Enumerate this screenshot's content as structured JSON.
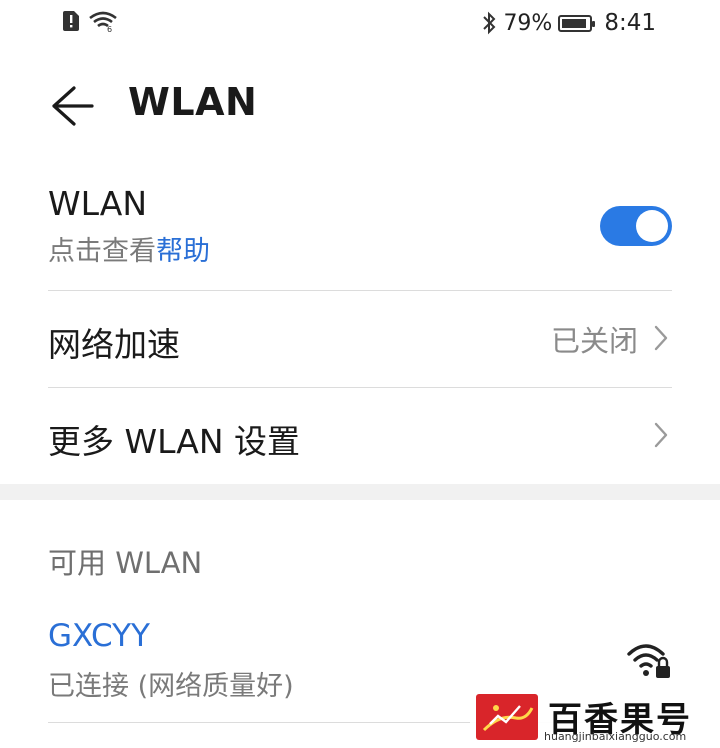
{
  "status_bar": {
    "battery_percent": "79%",
    "battery_level": 0.79,
    "time": "8:41",
    "icons": [
      "sim-alert-icon",
      "wifi-status-icon",
      "bluetooth-icon",
      "battery-icon"
    ]
  },
  "header": {
    "title": "WLAN"
  },
  "wlan_toggle": {
    "label": "WLAN",
    "hint_prefix": "点击查看",
    "hint_link": "帮助",
    "enabled": true,
    "accent_color": "#2a7ae4"
  },
  "network_accel": {
    "label": "网络加速",
    "value": "已关闭"
  },
  "more_settings": {
    "label": "更多 WLAN 设置"
  },
  "available": {
    "section_title": "可用 WLAN",
    "networks": [
      {
        "name": "GXCYY",
        "status": "已连接 (网络质量好)"
      }
    ]
  },
  "watermark": {
    "brand": "百香果号",
    "url": "huangjinbaixiangguo.com"
  }
}
